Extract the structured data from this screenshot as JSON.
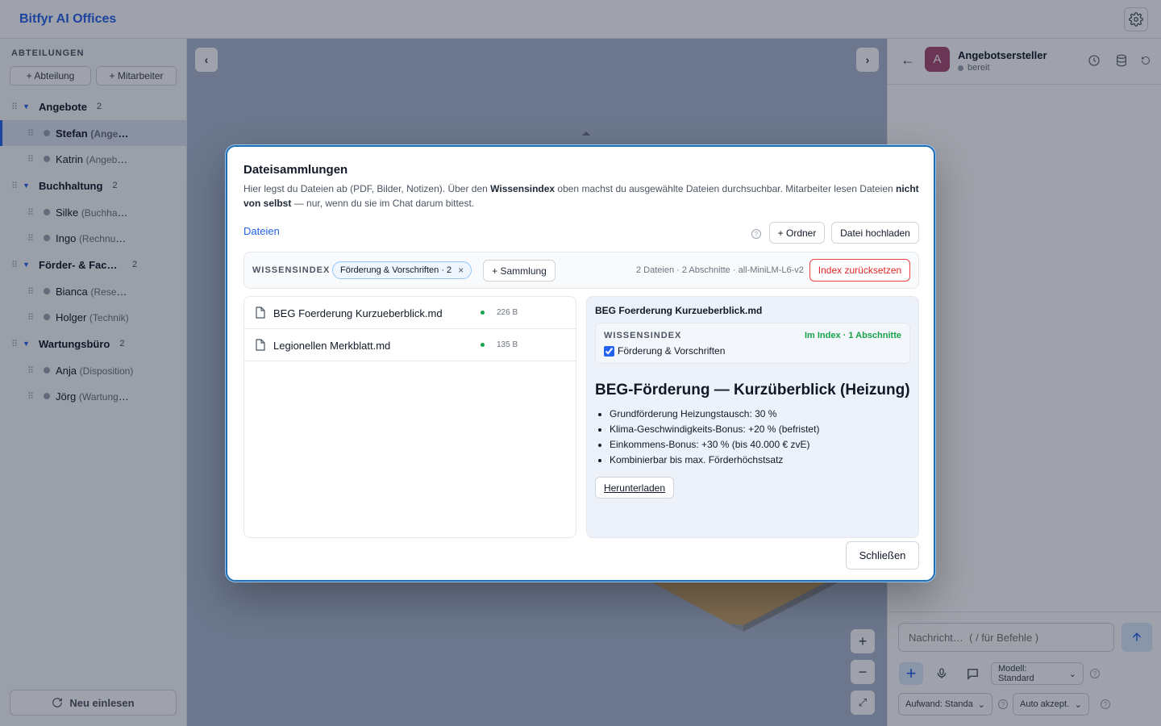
{
  "app": {
    "title": "Bitfyr AI Offices"
  },
  "sidebar": {
    "title": "ABTEILUNGEN",
    "add_department": "+ Abteilung",
    "add_employee": "+ Mitarbeiter",
    "departments": [
      {
        "name": "Angebote",
        "count": "2",
        "employees": [
          {
            "name": "Stefan",
            "role": "(Angeb…"
          },
          {
            "name": "Katrin",
            "role": "(Angebot…"
          }
        ]
      },
      {
        "name": "Buchhaltung",
        "count": "2",
        "employees": [
          {
            "name": "Silke",
            "role": "(Buchhalt…"
          },
          {
            "name": "Ingo",
            "role": "(Rechnun…"
          }
        ]
      },
      {
        "name": "Förder- & Fach…",
        "count": "2",
        "employees": [
          {
            "name": "Bianca",
            "role": "(Resear…"
          },
          {
            "name": "Holger",
            "role": "(Technik)"
          }
        ]
      },
      {
        "name": "Wartungsbüro",
        "count": "2",
        "employees": [
          {
            "name": "Anja",
            "role": "(Disposition)"
          },
          {
            "name": "Jörg",
            "role": "(Wartungs…"
          }
        ]
      }
    ],
    "reload_label": "Neu einlesen"
  },
  "canvas": {
    "prev": "‹",
    "next": "›",
    "zoom_in": "+",
    "zoom_out": "−",
    "fit": "⤢"
  },
  "chat": {
    "avatar_letter": "A",
    "agent_name": "Angebotsersteller",
    "agent_status": "bereit",
    "input_placeholder": "Nachricht…  ( / für Befehle )",
    "model_select": "Modell: Standard",
    "effort_select": "Aufwand: Standa",
    "accept_select": "Auto akzept."
  },
  "modal": {
    "title": "Dateisammlungen",
    "desc_1": "Hier legst du Dateien ab (PDF, Bilder, Notizen). Über den ",
    "desc_b1": "Wissensindex",
    "desc_2": " oben machst du ausgewählte Dateien durchsuchbar. Mitarbeiter lesen Dateien ",
    "desc_b2": "nicht von selbst",
    "desc_3": " — nur, wenn du sie im Chat darum bittest.",
    "tab_files": "Dateien",
    "folder_button": "+ Ordner",
    "upload_button": "Datei hochladen",
    "index": {
      "label": "WISSENSINDEX",
      "chip": "Förderung & Vorschriften · 2",
      "add_collection": "+ Sammlung",
      "stats": "2 Dateien · 2 Abschnitte · all-MiniLM-L6-v2",
      "reset": "Index zurücksetzen"
    },
    "files": [
      {
        "name": "BEG Foerderung Kurzueberblick.md",
        "size": "226 B"
      },
      {
        "name": "Legionellen Merkblatt.md",
        "size": "135 B"
      }
    ],
    "preview": {
      "file_title": "BEG Foerderung Kurzueberblick.md",
      "index_label": "WISSENSINDEX",
      "index_status": "Im Index · 1 Abschnitte",
      "collection_check": "Förderung & Vorschriften",
      "heading": "BEG-Förderung — Kurzüberblick (Heizung)",
      "bullets": [
        "Grundförderung Heizungstausch: 30 %",
        "Klima-Geschwindigkeits-Bonus: +20 % (befristet)",
        "Einkommens-Bonus: +30 % (bis 40.000 € zvE)",
        "Kombinierbar bis max. Förderhöchstsatz"
      ],
      "download": "Herunterladen"
    },
    "close": "Schließen"
  }
}
